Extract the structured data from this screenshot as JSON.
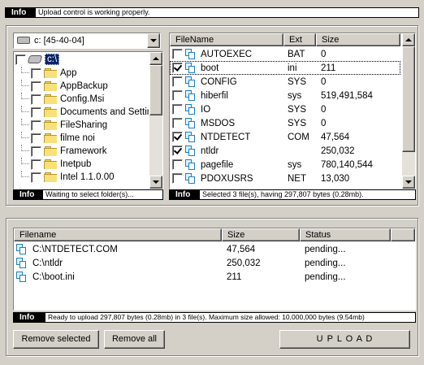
{
  "top_info": {
    "tag": "Info",
    "message": "Upload control is working properly."
  },
  "drive_select": {
    "value": "c: [45-40-04]"
  },
  "folder_tree": {
    "root_label": "c:\\",
    "folders": [
      "App",
      "AppBackup",
      "Config.Msi",
      "Documents and Settings",
      "FileSharing",
      "filme noi",
      "Framework",
      "Inetpub",
      "Intel 1.1.0.00"
    ],
    "status_tag": "Info",
    "status_message": "Waiting to select folder(s)..."
  },
  "file_list": {
    "columns": [
      "FileName",
      "Ext",
      "Size"
    ],
    "rows": [
      {
        "name": "AUTOEXEC",
        "ext": "BAT",
        "size": "0",
        "checked": false
      },
      {
        "name": "boot",
        "ext": "ini",
        "size": "211",
        "checked": true
      },
      {
        "name": "CONFIG",
        "ext": "SYS",
        "size": "0",
        "checked": false
      },
      {
        "name": "hiberfil",
        "ext": "sys",
        "size": "519,491,584",
        "checked": false
      },
      {
        "name": "IO",
        "ext": "SYS",
        "size": "0",
        "checked": false
      },
      {
        "name": "MSDOS",
        "ext": "SYS",
        "size": "0",
        "checked": false
      },
      {
        "name": "NTDETECT",
        "ext": "COM",
        "size": "47,564",
        "checked": true
      },
      {
        "name": "ntldr",
        "ext": "",
        "size": "250,032",
        "checked": true
      },
      {
        "name": "pagefile",
        "ext": "sys",
        "size": "780,140,544",
        "checked": false
      },
      {
        "name": "PDOXUSRS",
        "ext": "NET",
        "size": "13,030",
        "checked": false
      }
    ],
    "status_tag": "Info",
    "status_message": "Selected  3 file(s), having 297,807 bytes (0.28mb)."
  },
  "upload_queue": {
    "columns": [
      "Filename",
      "Size",
      "Status"
    ],
    "rows": [
      {
        "filename": "C:\\NTDETECT.COM",
        "size": "47,564",
        "status": "pending..."
      },
      {
        "filename": "C:\\ntldr",
        "size": "250,032",
        "status": "pending..."
      },
      {
        "filename": "C:\\boot.ini",
        "size": "211",
        "status": "pending..."
      }
    ],
    "status_tag": "Info",
    "status_message": "Ready to upload 297,807 bytes (0.28mb) in 3 file(s). Maximum size allowed: 10,000,000 bytes (9.54mb)"
  },
  "buttons": {
    "remove_selected": "Remove selected",
    "remove_all": "Remove all",
    "upload": "U P L O A D"
  }
}
